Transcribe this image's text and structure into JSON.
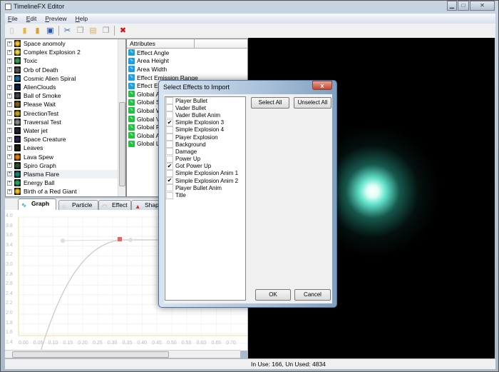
{
  "window": {
    "title": "TimelineFX Editor",
    "minimize": "▁",
    "maximize": "□",
    "close": "✕"
  },
  "menu": [
    "File",
    "Edit",
    "Preview",
    "Help"
  ],
  "toolbar": [
    {
      "icon": "new-file-icon",
      "glyph": "▯",
      "color": "#bbb"
    },
    {
      "icon": "open-folder-icon",
      "glyph": "▮",
      "color": "#e8b840"
    },
    {
      "icon": "import-icon",
      "glyph": "▮",
      "color": "#d8a030"
    },
    {
      "icon": "save-icon",
      "glyph": "▣",
      "color": "#2050b0"
    },
    {
      "icon": "cut-icon",
      "glyph": "✂",
      "color": "#3060b0"
    },
    {
      "icon": "copy-icon",
      "glyph": "❐",
      "color": "#999"
    },
    {
      "icon": "paste-icon",
      "glyph": "▤",
      "color": "#d8b060"
    },
    {
      "icon": "duplicate-icon",
      "glyph": "❐",
      "color": "#999"
    },
    {
      "icon": "delete-icon",
      "glyph": "✖",
      "color": "#d01010"
    }
  ],
  "effects_tree": [
    {
      "label": "Space anomoly",
      "color": "#f5c030"
    },
    {
      "label": "Complex Explosion 2",
      "color": "#f0d040"
    },
    {
      "label": "Toxic",
      "color": "#3a9a50"
    },
    {
      "label": "Orb of Death",
      "color": "#555"
    },
    {
      "label": "Cosmic Alien Spiral",
      "color": "#1a6a9a"
    },
    {
      "label": "AlienClouds",
      "color": "#102040"
    },
    {
      "label": "Ball of Smoke",
      "color": "#444"
    },
    {
      "label": "Please Wait",
      "color": "#806020"
    },
    {
      "label": "DirectionTest",
      "color": "#c0a020"
    },
    {
      "label": "Traversal Test",
      "color": "#888"
    },
    {
      "label": "Water jet",
      "color": "#223"
    },
    {
      "label": "Space Creature",
      "color": "#302050"
    },
    {
      "label": "Leaves",
      "color": "#202010"
    },
    {
      "label": "Lava Spew",
      "color": "#e08010"
    },
    {
      "label": "Spiro Graph",
      "color": "#305030"
    },
    {
      "label": "Plasma Flare",
      "color": "#208070"
    },
    {
      "label": "Energy Ball",
      "color": "#30a060"
    },
    {
      "label": "Birth of a Red Giant",
      "color": "#f0c020"
    }
  ],
  "attributes": {
    "header": "Attributes",
    "items": [
      {
        "label": "Effect Angle",
        "color": "#1aa0e0"
      },
      {
        "label": "Area Height",
        "color": "#1aa0e0"
      },
      {
        "label": "Area Width",
        "color": "#1aa0e0"
      },
      {
        "label": "Effect Emission Range",
        "color": "#1aa0e0"
      },
      {
        "label": "Effect Emission Angle",
        "color": "#1aa0e0"
      },
      {
        "label": "Global Amount",
        "color": "#20c040"
      },
      {
        "label": "Global Speed",
        "color": "#20c040"
      },
      {
        "label": "Global Weight",
        "color": "#20c040"
      },
      {
        "label": "Global Velocity",
        "color": "#20c040"
      },
      {
        "label": "Global Particle Size",
        "color": "#20c040"
      },
      {
        "label": "Global Alpha",
        "color": "#20c040"
      },
      {
        "label": "Global Life",
        "color": "#20c040"
      }
    ]
  },
  "tabs": [
    {
      "label": "Graph",
      "active": true
    },
    {
      "label": "Particle"
    },
    {
      "label": "Effect"
    },
    {
      "label": "Shapes"
    }
  ],
  "graph": {
    "y_ticks": [
      "4.0",
      "3.8",
      "3.6",
      "3.4",
      "3.2",
      "3.0",
      "2.8",
      "2.6",
      "2.4",
      "2.2",
      "2.0",
      "1.8",
      "1.6",
      "1.4"
    ],
    "x_ticks": [
      "0.00",
      "0.05",
      "0.10",
      "0.15",
      "0.20",
      "0.25",
      "0.30",
      "0.35",
      "0.40",
      "0.45",
      "0.50",
      "0.55",
      "0.60",
      "0.65",
      "0.70"
    ],
    "axis_color": "#f5d890",
    "selected_node_color": "#f06060"
  },
  "dialog": {
    "title": "Select Effects to Import",
    "select_all": "Select All",
    "unselect_all": "Unselect All",
    "ok": "OK",
    "cancel": "Cancel",
    "items": [
      {
        "label": "Player Bullet",
        "checked": false
      },
      {
        "label": "Vader Bullet",
        "checked": false
      },
      {
        "label": "Vader Bullet Anim",
        "checked": false
      },
      {
        "label": "Simple Explosion 3",
        "checked": true
      },
      {
        "label": "Simple Explosion 4",
        "checked": false
      },
      {
        "label": "Player Explosion",
        "checked": false
      },
      {
        "label": "Background",
        "checked": false
      },
      {
        "label": "Damage",
        "checked": false
      },
      {
        "label": "Power Up",
        "checked": false
      },
      {
        "label": "Got Power Up",
        "checked": true
      },
      {
        "label": "Simple Explosion Anim 1",
        "checked": false
      },
      {
        "label": "Simple Explosion Anim 2",
        "checked": true
      },
      {
        "label": "Player Bullet Anim",
        "checked": false
      },
      {
        "label": "Title",
        "checked": false
      }
    ]
  },
  "status": {
    "text": "In Use: 166, Un Used: 4834"
  }
}
